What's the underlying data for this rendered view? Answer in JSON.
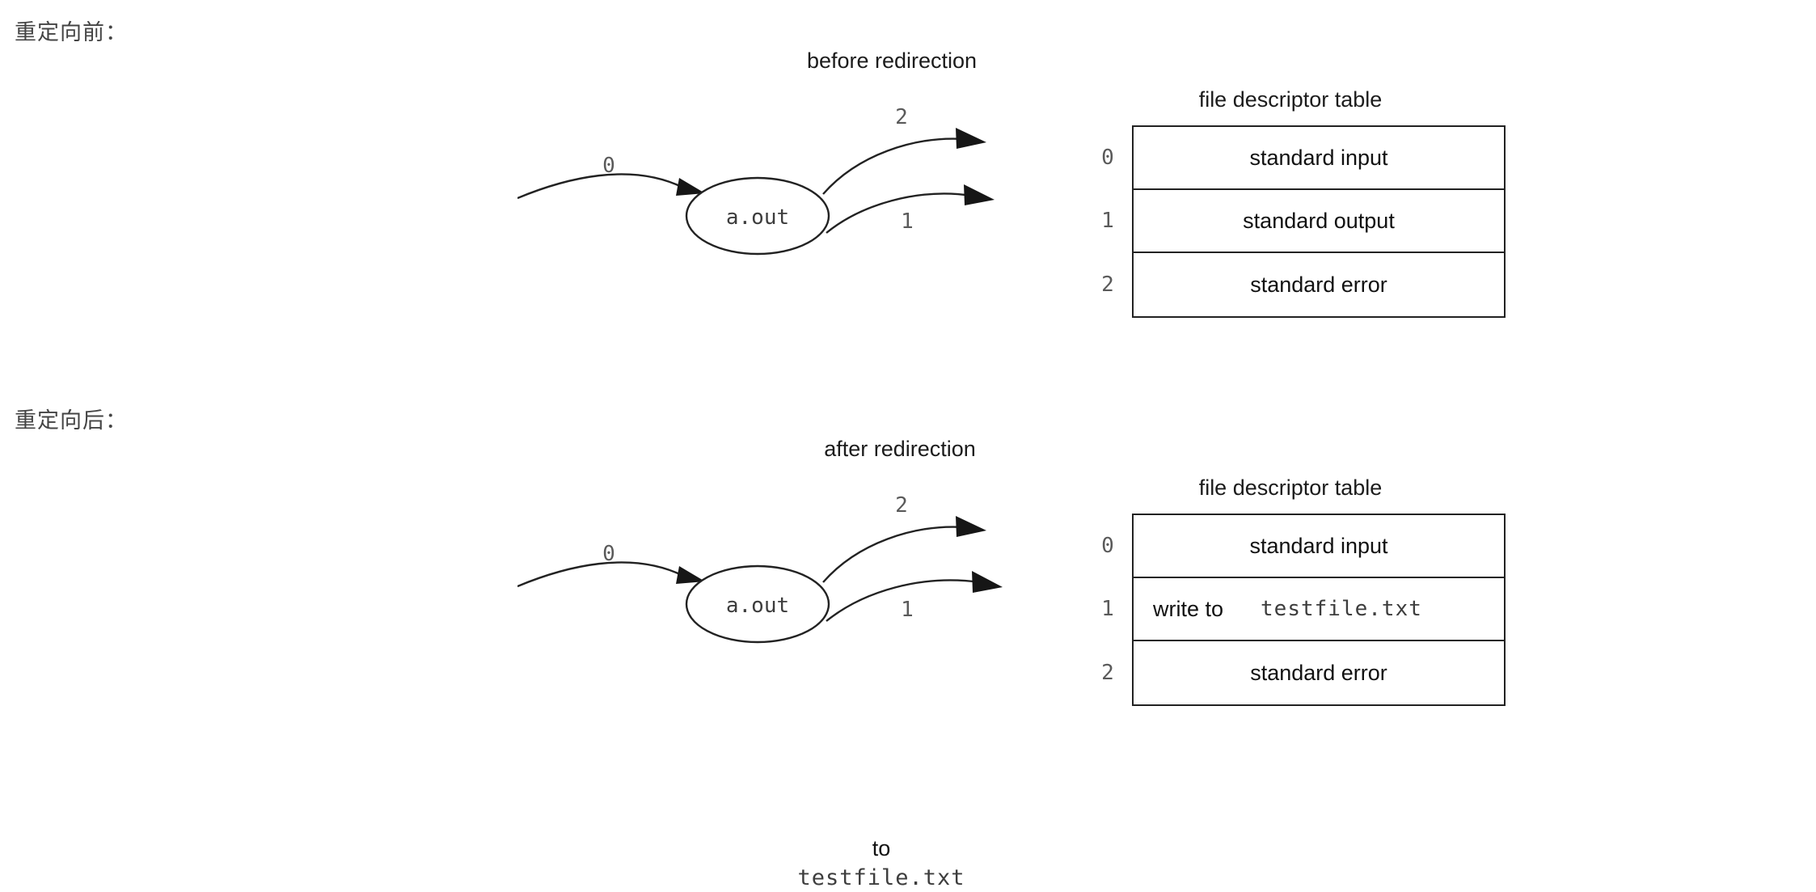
{
  "page": {
    "heading_before": "重定向前：",
    "heading_after": "重定向后："
  },
  "figures": [
    {
      "id": "before",
      "title": "before redirection",
      "process": {
        "name": "a.out",
        "in_label": "0",
        "out_upper_label": "2",
        "out_lower_label": "1"
      },
      "fd_table": {
        "caption": "file descriptor table",
        "rows": [
          {
            "index": "0",
            "text": "standard input"
          },
          {
            "index": "1",
            "text": "standard output"
          },
          {
            "index": "2",
            "text": "standard error"
          }
        ]
      }
    },
    {
      "id": "after",
      "title": "after redirection",
      "process": {
        "name": "a.out",
        "in_label": "0",
        "out_upper_label": "2",
        "out_lower_label": "1"
      },
      "redirect_caption": {
        "to": "to",
        "file": "testfile.txt"
      },
      "fd_table": {
        "caption": "file descriptor table",
        "rows": [
          {
            "index": "0",
            "text": "standard input"
          },
          {
            "index": "1",
            "text": "write to",
            "mono": "testfile.txt"
          },
          {
            "index": "2",
            "text": "standard error"
          }
        ]
      }
    }
  ],
  "colors": {
    "ink": "#222222",
    "text": "#111111",
    "muted": "#5a5a5a",
    "mono": "#3d3d3d",
    "background": "#ffffff"
  }
}
